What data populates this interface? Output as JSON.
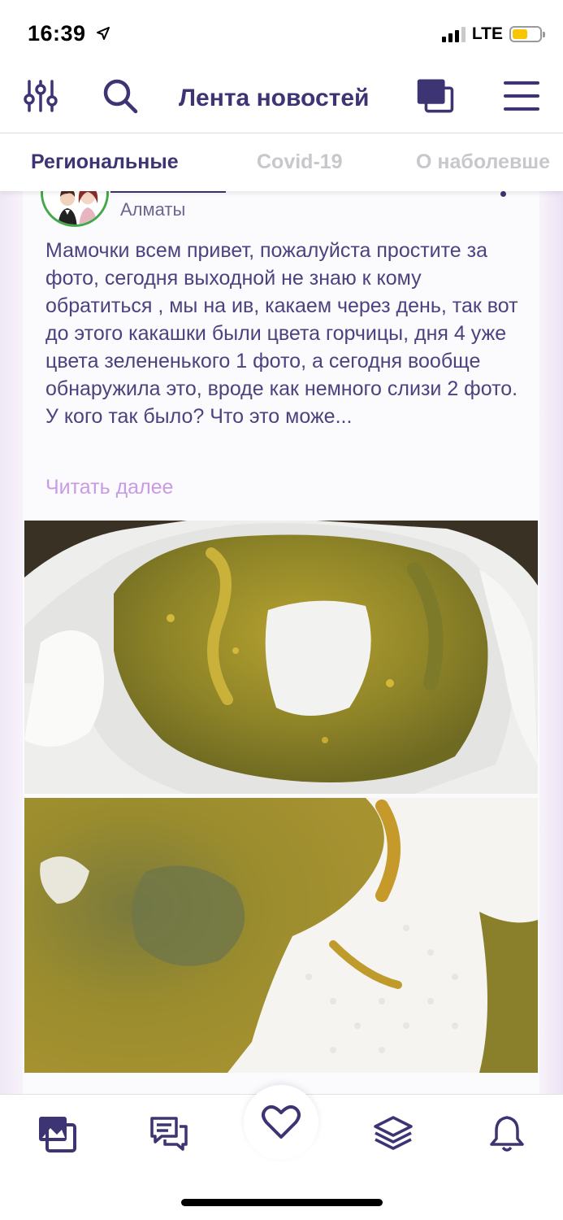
{
  "status": {
    "time": "16:39",
    "network": "LTE",
    "battery_level": 0.55
  },
  "header": {
    "title": "Лента новостей",
    "icons": [
      "filter-icon",
      "search-icon",
      "gallery-icon",
      "menu-icon"
    ]
  },
  "tabs": [
    {
      "label": "Региональные",
      "active": true
    },
    {
      "label": "Covid-19",
      "active": false
    },
    {
      "label": "О наболевше",
      "active": false
    }
  ],
  "post": {
    "city": "Алматы",
    "text": "Мамочки всем привет, пожалуйста простите за фото, сегодня выходной не знаю к кому обратиться , мы на ив, какаем через день, так вот до этого какашки были цвета горчицы, дня 4 уже цвета зелененького 1 фото, а сегодня вообще обнаружила это, вроде как немного слизи 2 фото. У кого так было? Что это може...",
    "read_more": "Читать далее",
    "photos": [
      "photo-1",
      "photo-2"
    ]
  },
  "bottom_nav": {
    "items": [
      "photos-icon",
      "chat-icon",
      "heart-icon",
      "layers-icon",
      "bell-icon"
    ]
  },
  "colors": {
    "brand": "#3d3573",
    "accent": "#c99be3",
    "inactive_tab": "#c7c7cc"
  }
}
